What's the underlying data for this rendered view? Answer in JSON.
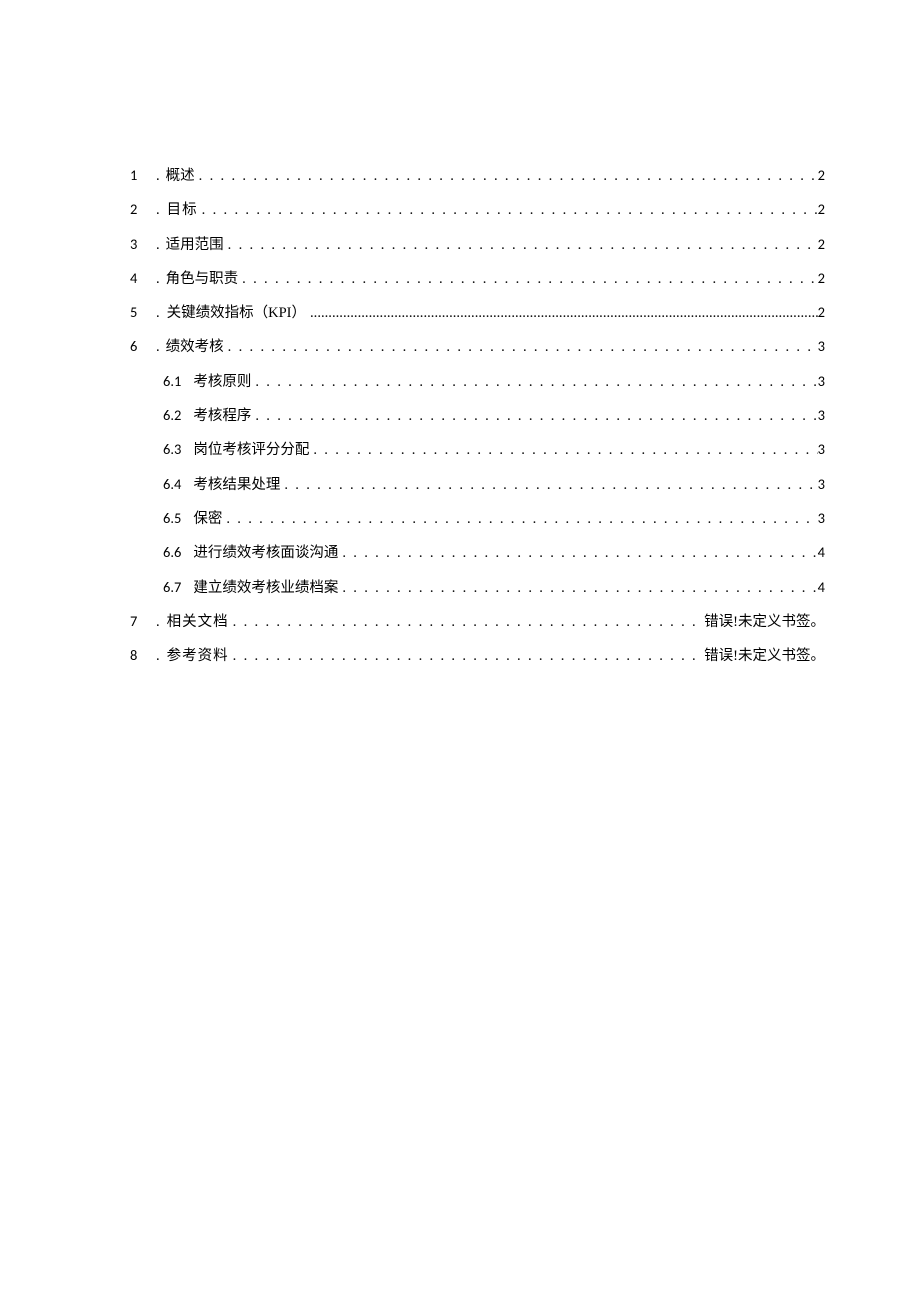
{
  "toc": {
    "items": [
      {
        "num": "1",
        "title": "概述",
        "page": "2"
      },
      {
        "num": "2",
        "title": "目标",
        "page": "2",
        "spaced": true
      },
      {
        "num": "3",
        "title": "适用范围",
        "page": "2"
      },
      {
        "num": "4",
        "title": "角色与职责",
        "page": "2"
      },
      {
        "num": "5",
        "title": "关键绩效指标（KPI）",
        "page": "2",
        "kpi": true
      },
      {
        "num": "6",
        "title": "绩效考核",
        "page": "3"
      },
      {
        "num": "6.1",
        "title": "考核原则",
        "page": "3",
        "sub": true
      },
      {
        "num": "6.2",
        "title": "考核程序",
        "page": "3",
        "sub": true
      },
      {
        "num": "6.3",
        "title": "岗位考核评分分配",
        "page": "3",
        "sub": true
      },
      {
        "num": "6.4",
        "title": "考核结果处理",
        "page": "3",
        "sub": true
      },
      {
        "num": "6.5",
        "title": "保密",
        "page": "3",
        "sub": true
      },
      {
        "num": "6.6",
        "title": "进行绩效考核面谈沟通",
        "page": "4",
        "sub": true
      },
      {
        "num": "6.7",
        "title": "建立绩效考核业绩档案",
        "page": "4",
        "sub": true
      },
      {
        "num": "7",
        "title": "相关文档",
        "page": "错误!未定义书签。",
        "spaced": true,
        "error": true
      },
      {
        "num": "8",
        "title": "参考资料",
        "page": "错误!未定义书签。",
        "spaced": true,
        "error": true
      }
    ],
    "sep": ".",
    "dots_fill": ". . . . . . . . . . . . . . . . . . . . . . . . . . . . . . . . . . . . . . . . . . . . . . . . . . . . . . . . . . . . . . . . . . . . . . . . . . . . . . . . . . . . . . . . . . . . . . . . . . . .",
    "dots_tight_fill": "........................................................................................................................................................................................................"
  }
}
